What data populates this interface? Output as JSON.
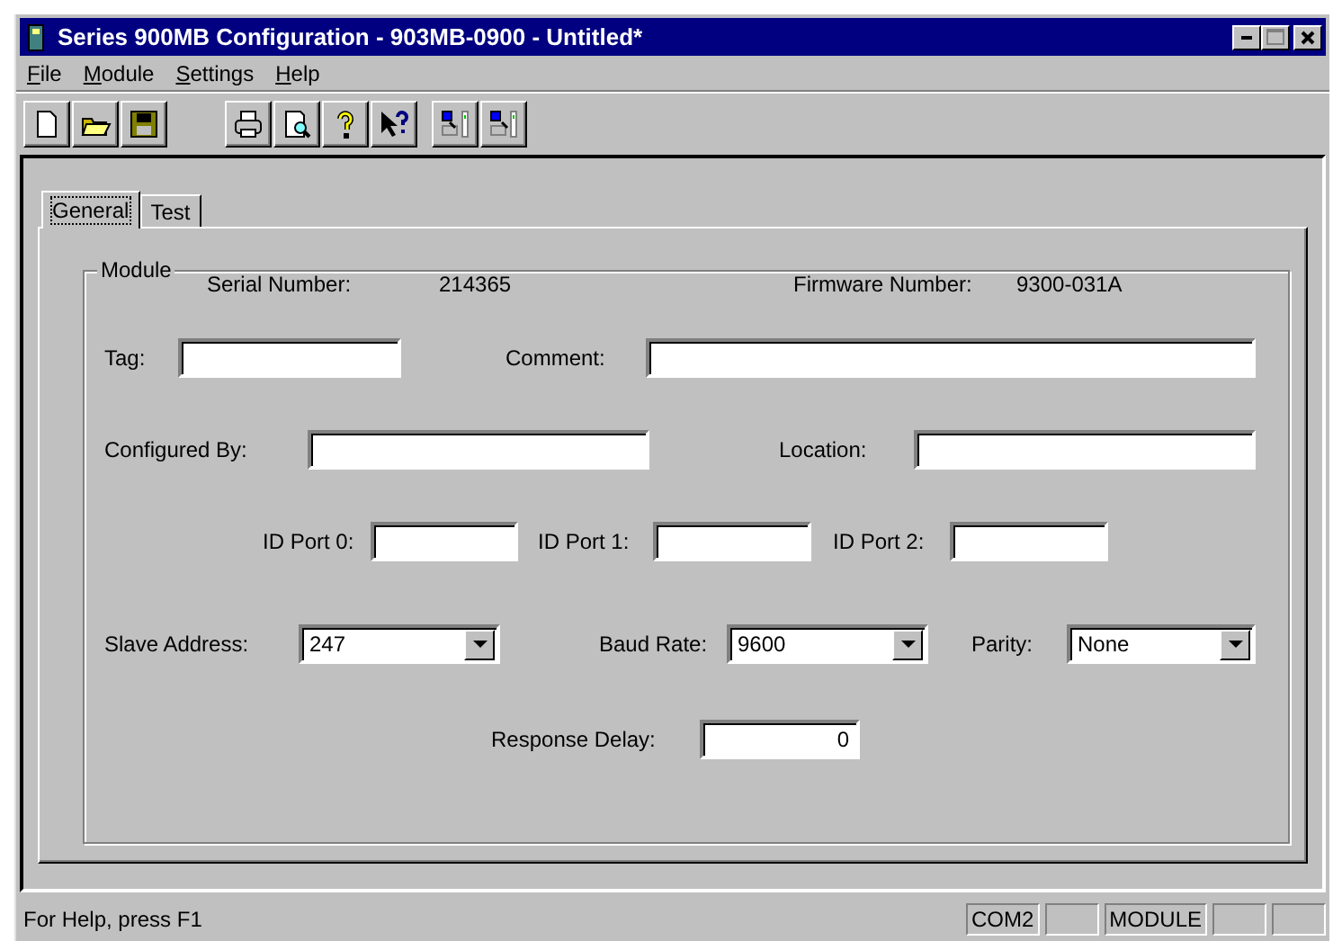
{
  "window": {
    "title": "Series 900MB Configuration - 903MB-0900 - Untitled*"
  },
  "menu": [
    {
      "label": "File"
    },
    {
      "label": "Module"
    },
    {
      "label": "Settings"
    },
    {
      "label": "Help"
    }
  ],
  "tabs": [
    {
      "label": "General",
      "selected": true
    },
    {
      "label": "Test",
      "selected": false
    }
  ],
  "group": {
    "title": "Module",
    "info": [
      {
        "label": "Serial Number:",
        "value": "214365"
      },
      {
        "label": "Firmware Number:",
        "value": "9300-031A"
      }
    ],
    "fields": [
      {
        "kind": "text",
        "label": "Tag:"
      },
      {
        "kind": "text",
        "label": "Comment:"
      },
      {
        "kind": "text",
        "label": "Configured By:"
      },
      {
        "kind": "text",
        "label": "Location:"
      },
      {
        "kind": "text",
        "label": "ID Port 0:"
      },
      {
        "kind": "text",
        "label": "ID Port 1:"
      },
      {
        "kind": "text",
        "label": "ID Port 2:"
      },
      {
        "kind": "combo",
        "label": "Slave Address:",
        "value": "247"
      },
      {
        "kind": "combo",
        "label": "Baud Rate:",
        "value": "9600"
      },
      {
        "kind": "combo",
        "label": "Parity:",
        "value": "None"
      },
      {
        "kind": "number",
        "label": "Response Delay:",
        "value": "0"
      }
    ]
  },
  "status_bar": {
    "text": "For Help, press F1",
    "panes": [
      "COM2",
      "MODULE"
    ]
  }
}
